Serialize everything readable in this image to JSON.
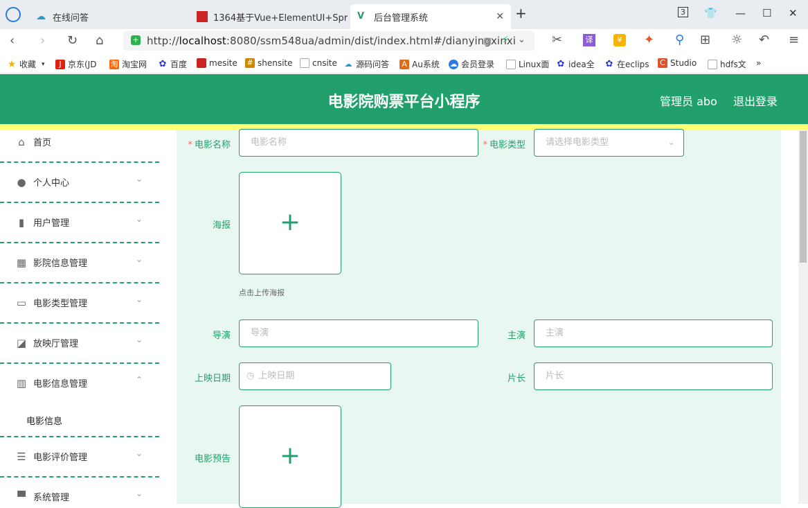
{
  "browser": {
    "tabs": [
      {
        "label": "在线问答"
      },
      {
        "label": "1364基于Vue+ElementUI+Spr"
      },
      {
        "label": "后台管理系统"
      }
    ],
    "tab_count": "3",
    "url_prefix": "http://",
    "url_host": "localhost",
    "url_rest": ":8080/ssm548ua/admin/dist/index.html#/dianyingxinxi",
    "bookmarks": [
      {
        "label": "收藏"
      },
      {
        "label": "京东(JD"
      },
      {
        "label": "淘宝网"
      },
      {
        "label": "百度"
      },
      {
        "label": "mesite"
      },
      {
        "label": "shensite"
      },
      {
        "label": "cnsite"
      },
      {
        "label": "源码问答"
      },
      {
        "label": "Au系统"
      },
      {
        "label": "会员登录"
      },
      {
        "label": "Linux面"
      },
      {
        "label": "idea全"
      },
      {
        "label": "在eclips"
      },
      {
        "label": "Studio"
      },
      {
        "label": "hdfs文"
      },
      {
        "label": "»"
      }
    ]
  },
  "header": {
    "title": "电影院购票平台小程序",
    "user": "管理员 abo",
    "logout": "退出登录"
  },
  "sidebar": {
    "items": [
      {
        "label": "首页",
        "icon": "home-icon"
      },
      {
        "label": "个人中心",
        "icon": "person-icon"
      },
      {
        "label": "用户管理",
        "icon": "book-icon"
      },
      {
        "label": "影院信息管理",
        "icon": "grid-icon"
      },
      {
        "label": "电影类型管理",
        "icon": "chat-icon"
      },
      {
        "label": "放映厅管理",
        "icon": "chart-icon"
      },
      {
        "label": "电影信息管理",
        "icon": "bar-chart-icon"
      },
      {
        "label": "电影评价管理",
        "icon": "sliders-icon"
      },
      {
        "label": "系统管理",
        "icon": "monitor-icon"
      }
    ],
    "sub_item": "电影信息"
  },
  "form": {
    "movie_name_label": "电影名称",
    "movie_name_placeholder": "电影名称",
    "movie_type_label": "电影类型",
    "movie_type_placeholder": "请选择电影类型",
    "poster_label": "海报",
    "poster_hint": "点击上传海报",
    "director_label": "导演",
    "director_placeholder": "导演",
    "actor_label": "主演",
    "actor_placeholder": "主演",
    "release_label": "上映日期",
    "release_placeholder": "上映日期",
    "duration_label": "片长",
    "duration_placeholder": "片长",
    "trailer_label": "电影预告",
    "required_mark": "*",
    "plus": "+"
  },
  "colors": {
    "accent": "#21a06c",
    "highlight": "#ffff73",
    "required": "#f56c6c"
  }
}
